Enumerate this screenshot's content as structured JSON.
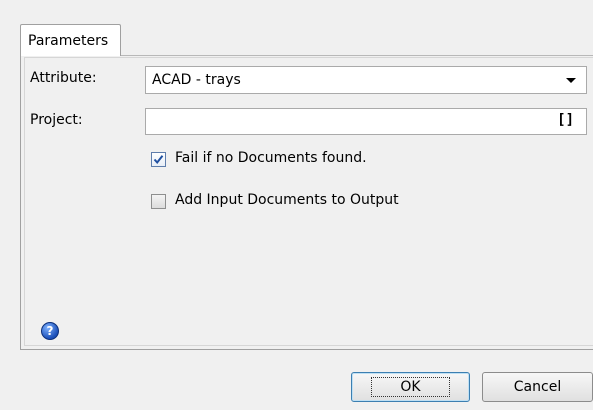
{
  "tabs": [
    {
      "label": "Parameters"
    }
  ],
  "form": {
    "attribute_label": "Attribute:",
    "attribute_value": "ACAD - trays",
    "project_label": "Project:",
    "project_value": "",
    "project_button": "[]"
  },
  "options": [
    {
      "label": "Fail if no Documents found.",
      "checked": true
    },
    {
      "label": "Add Input Documents to Output",
      "checked": false
    }
  ],
  "help_icon": {
    "glyph": "?",
    "icon": "help-icon"
  },
  "buttons": {
    "ok": "OK",
    "cancel": "Cancel"
  },
  "colors": {
    "accent": "#3c7fb1",
    "panel": "#f0f0f0",
    "field": "#ffffff"
  }
}
